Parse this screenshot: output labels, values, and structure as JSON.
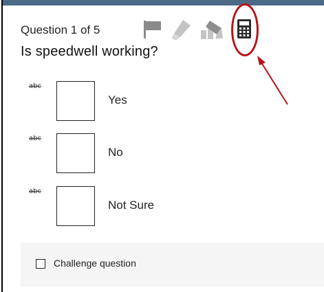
{
  "header": {
    "question_counter": "Question 1 of 5"
  },
  "toolbar": {
    "icons": [
      "flag-icon",
      "highlighter-icon",
      "answer-eliminator-icon",
      "calculator-icon"
    ]
  },
  "question": {
    "text": "Is speedwell working?"
  },
  "answers": [
    {
      "strike_label": "abc",
      "label": "Yes"
    },
    {
      "strike_label": "abc",
      "label": "No"
    },
    {
      "strike_label": "abc",
      "label": "Not Sure"
    }
  ],
  "footer": {
    "challenge_label": "Challenge question"
  },
  "colors": {
    "top_bar": "#4b6a86",
    "annotation": "#b51218",
    "challenge_background": "#f5f5f5"
  }
}
